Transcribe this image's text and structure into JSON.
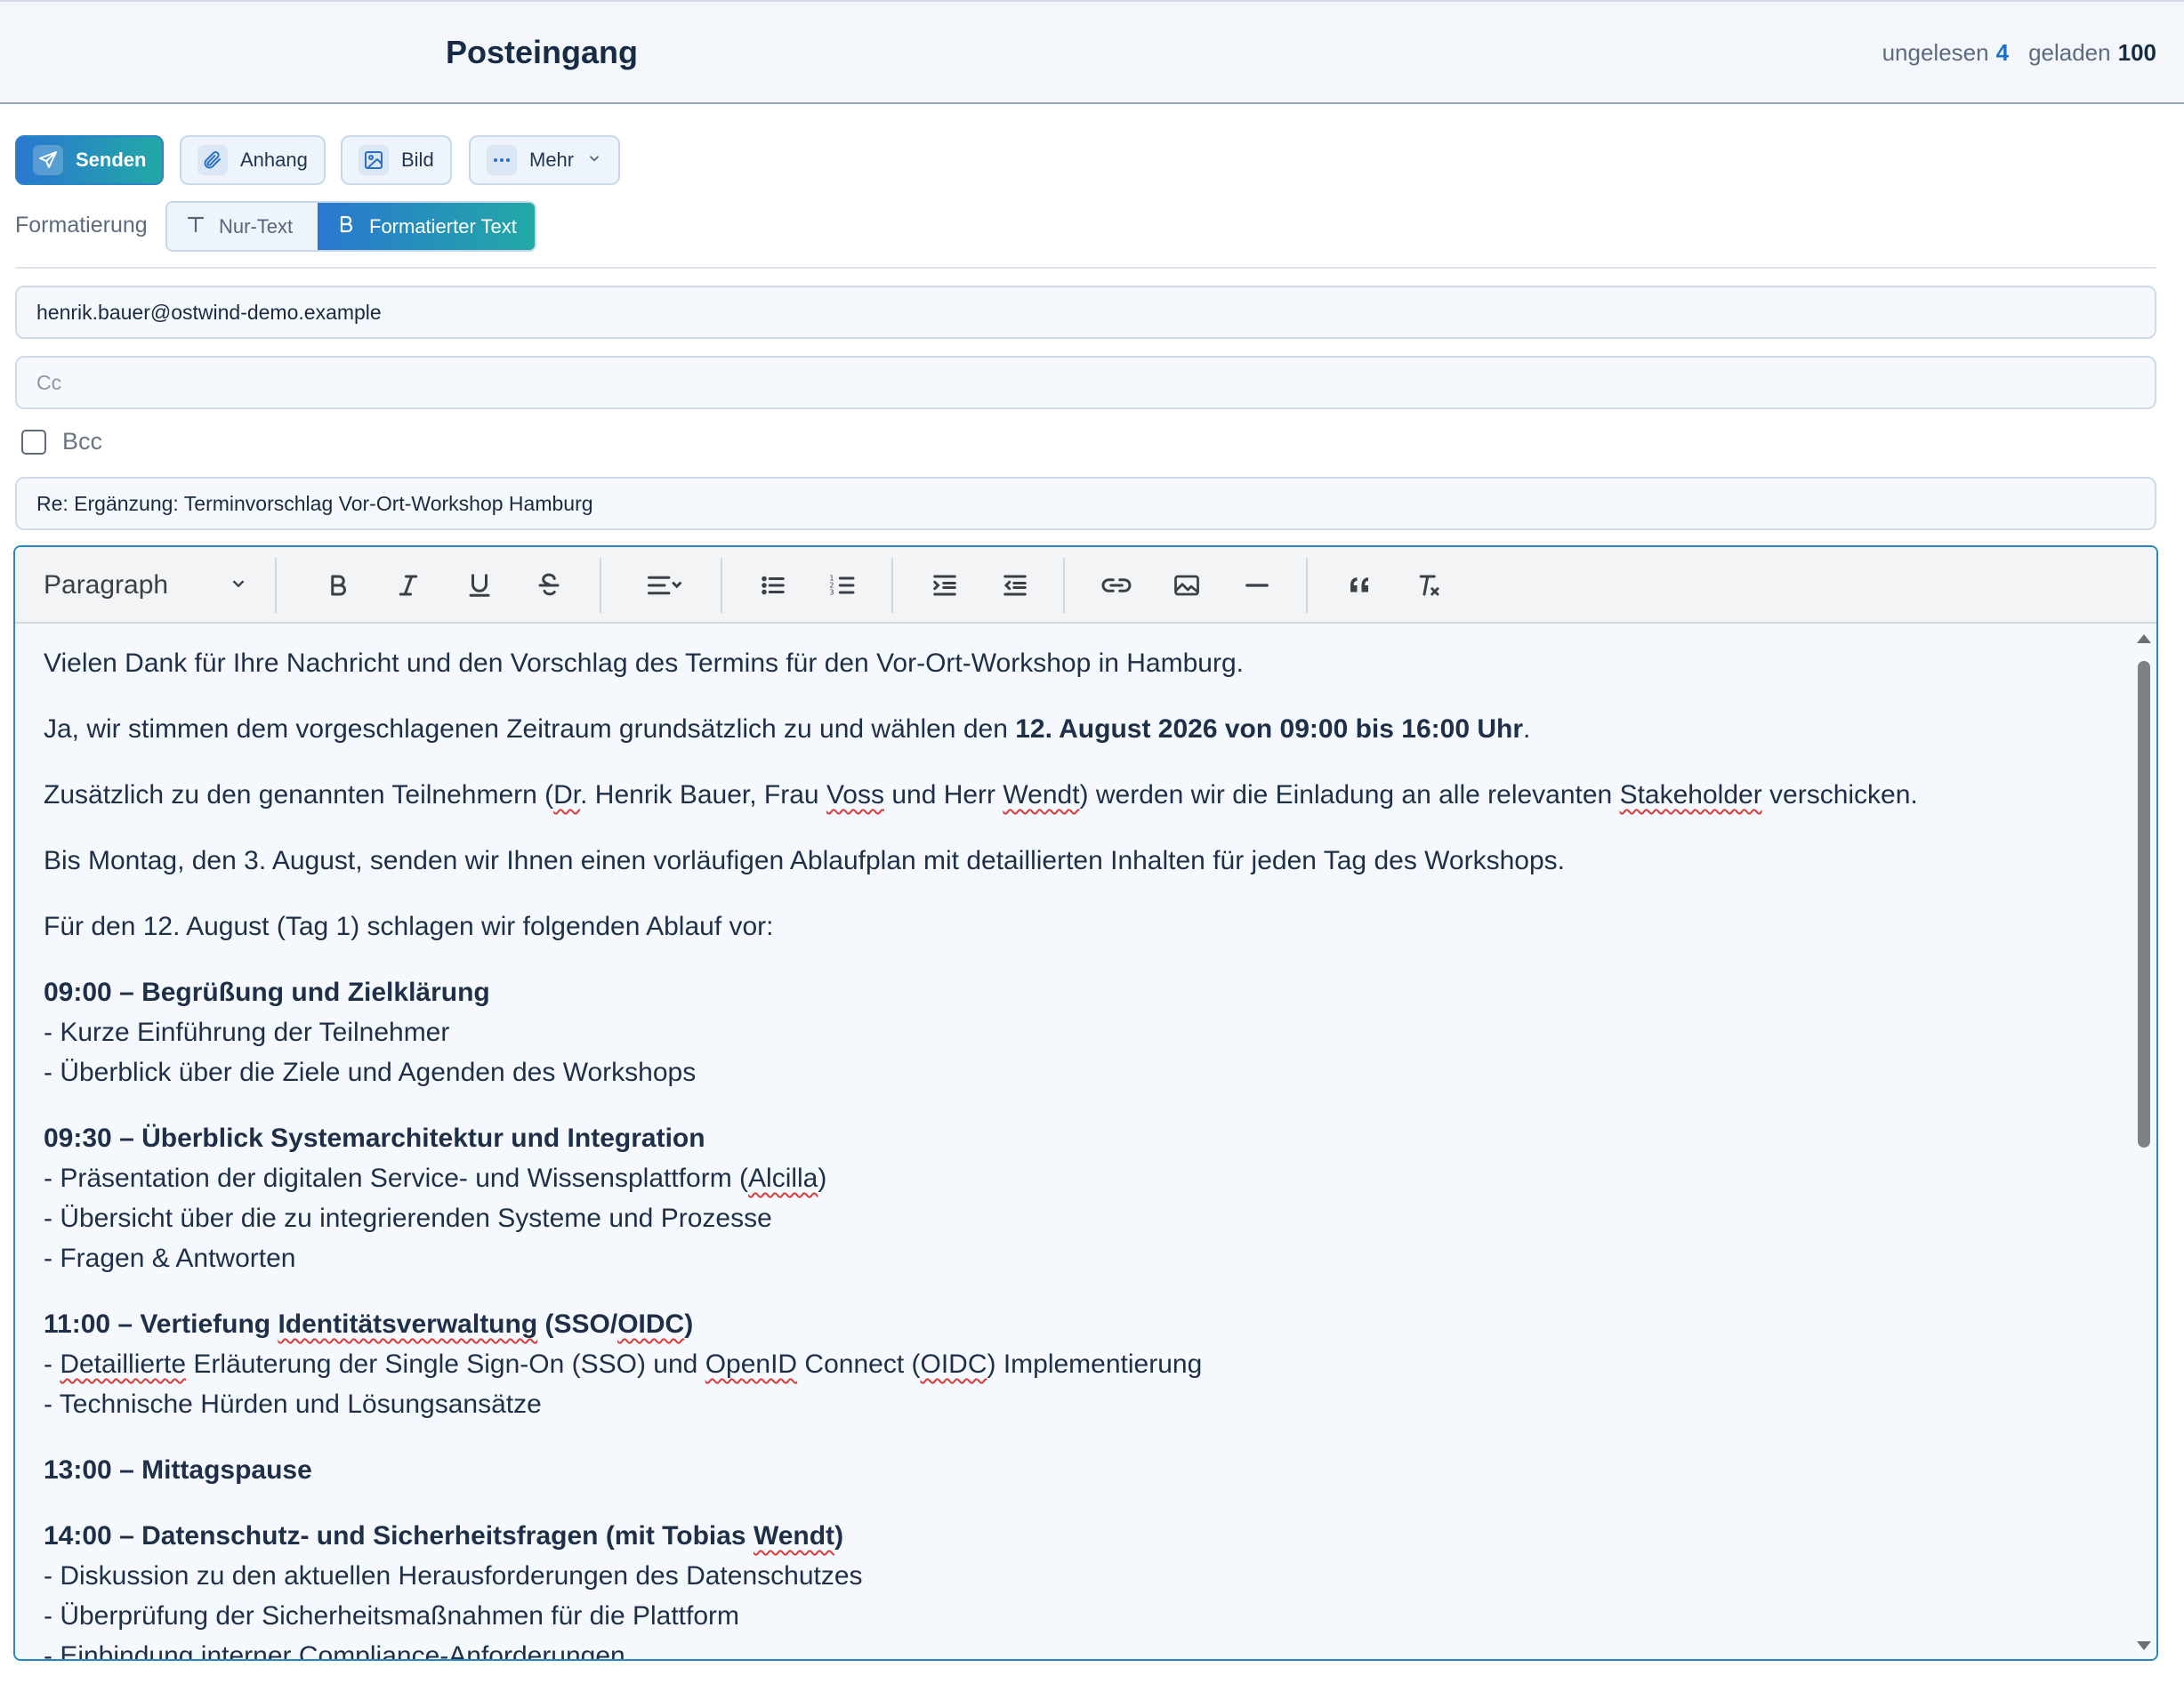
{
  "header": {
    "title": "Posteingang",
    "unread_label": "ungelesen",
    "unread_count": "4",
    "loaded_label": "geladen",
    "loaded_count": "100"
  },
  "toolbar": {
    "send_label": "Senden",
    "attach_label": "Anhang",
    "image_label": "Bild",
    "more_label": "Mehr"
  },
  "format": {
    "label": "Formatierung",
    "plain_label": "Nur-Text",
    "rich_label": "Formatierter Text",
    "selected": "Formatierter Text"
  },
  "compose": {
    "to_value": "henrik.bauer@ostwind-demo.example",
    "cc_placeholder": "Cc",
    "cc_value": "",
    "bcc_label": "Bcc",
    "bcc_checked": false,
    "subject_value": "Re: Ergänzung: Terminvorschlag Vor-Ort-Workshop Hamburg"
  },
  "editor": {
    "block_format": "Paragraph",
    "toolbar_icons": [
      "bold-icon",
      "italic-icon",
      "underline-icon",
      "strikethrough-icon",
      "align-icon",
      "bullet-list-icon",
      "numbered-list-icon",
      "indent-icon",
      "outdent-icon",
      "link-icon",
      "image-icon",
      "horizontal-rule-icon",
      "quote-icon",
      "clear-format-icon"
    ],
    "p1": "Vielen Dank für Ihre Nachricht und den Vorschlag des Termins für den Vor-Ort-Workshop in Hamburg.",
    "p2_pre": "Ja, wir stimmen dem vorgeschlagenen Zeitraum grundsätzlich zu und wählen den ",
    "p2_bold": "12. August 2026 von 09:00 bis 16:00 Uhr",
    "p2_post": ".",
    "p3_a": "Zusätzlich zu den genannten Teilnehmern (",
    "p3_dr": "Dr",
    "p3_b": ". Henrik Bauer, Frau ",
    "p3_voss": "Voss",
    "p3_c": " und Herr ",
    "p3_wendt": "Wendt",
    "p3_d": ") werden wir die Einladung an alle relevanten ",
    "p3_stakeholder": "Stakeholder",
    "p3_e": " verschicken.",
    "p4": "Bis Montag, den 3. August, senden wir Ihnen einen vorläufigen Ablaufplan mit detaillierten Inhalten für jeden Tag des Workshops.",
    "p5": "Für den 12. August (Tag 1) schlagen wir folgenden Ablauf vor:",
    "s1_title": "09:00 – Begrüßung und Zielklärung",
    "s1_l1": "- Kurze Einführung der Teilnehmer",
    "s1_l2": "- Überblick über die Ziele und Agenden des Workshops",
    "s2_title": "09:30 – Überblick Systemarchitektur und Integration",
    "s2_l1_a": "- Präsentation der digitalen Service- und Wissensplattform (",
    "s2_l1_alcilla": "Alcilla",
    "s2_l1_b": ")",
    "s2_l2": "- Übersicht über die zu integrierenden Systeme und Prozesse",
    "s2_l3": "- Fragen & Antworten",
    "s3_title_a": "11:00 – Vertiefung ",
    "s3_title_idv": "Identitätsverwaltung",
    "s3_title_b": " (SSO/",
    "s3_title_oidc": "OIDC",
    "s3_title_c": ")",
    "s3_l1_a": "- ",
    "s3_l1_detailed": "Detaillierte",
    "s3_l1_b": " Erläuterung der Single Sign-On (SSO) und ",
    "s3_l1_openid": "OpenID",
    "s3_l1_c": " Connect (",
    "s3_l1_oidc": "OIDC",
    "s3_l1_d": ") Implementierung",
    "s3_l2": "- Technische Hürden und Lösungsansätze",
    "s4_title": "13:00 – Mittagspause",
    "s5_title_a": "14:00 – Datenschutz- und Sicherheitsfragen (mit Tobias ",
    "s5_title_wendt": "Wendt",
    "s5_title_b": ")",
    "s5_l1": "- Diskussion zu den aktuellen Herausforderungen des Datenschutzes",
    "s5_l2": "- Überprüfung der Sicherheitsmaßnahmen für die Plattform",
    "s5_l3": "- Einbindung interner Compliance-Anforderungen"
  }
}
